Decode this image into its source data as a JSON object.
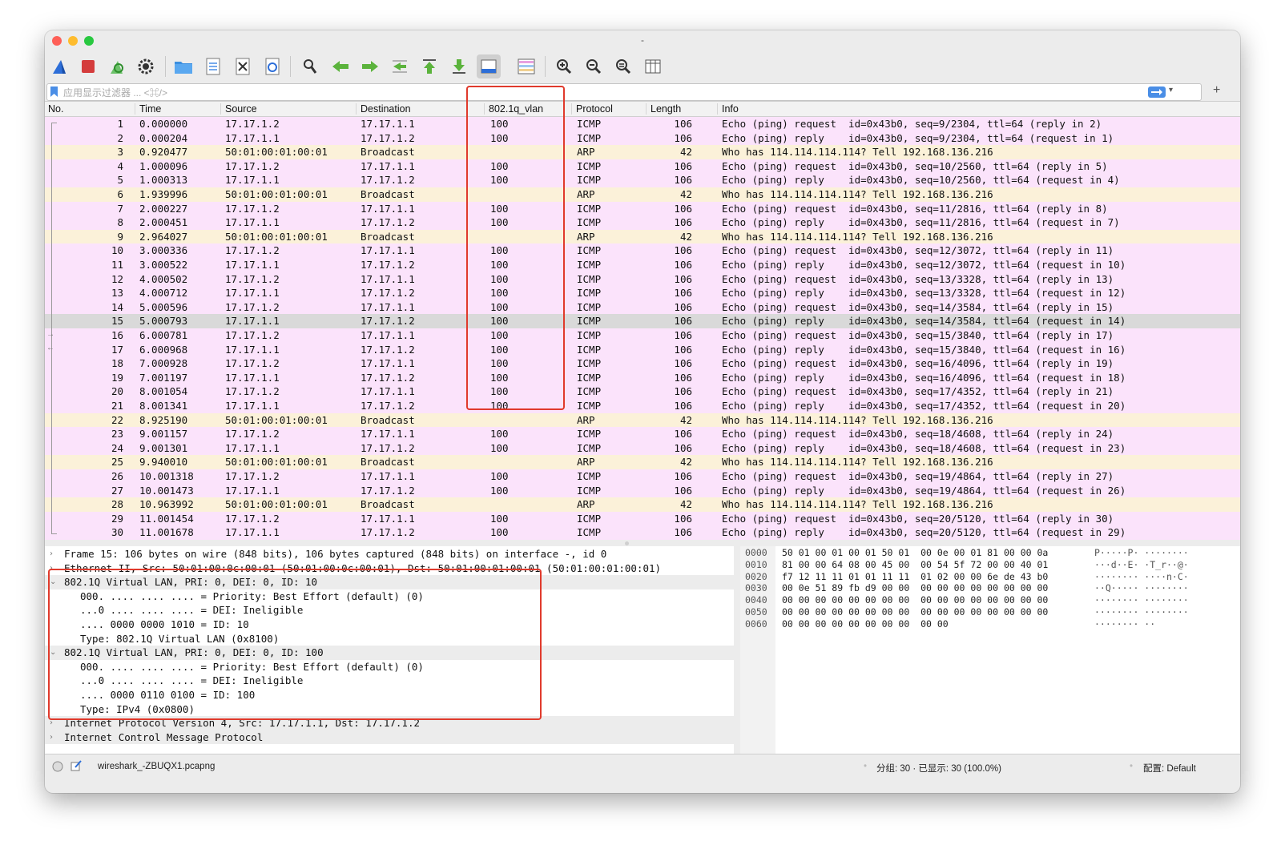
{
  "window": {
    "title": "-"
  },
  "filter": {
    "placeholder": "应用显示过滤器 ... <⌘/>"
  },
  "toolbar": {
    "icons": [
      "shark-fin-start-icon",
      "stop-capture-icon",
      "restart-capture-icon",
      "capture-options-gear-icon",
      "open-folder-icon",
      "save-file-icon",
      "close-file-icon",
      "reload-icon",
      "find-packet-icon",
      "go-back-arrow-icon",
      "go-forward-arrow-icon",
      "go-to-packet-icon",
      "go-first-packet-icon",
      "go-last-packet-icon",
      "autoscroll-icon",
      "colorize-icon",
      "zoom-in-icon",
      "zoom-out-icon",
      "zoom-reset-icon",
      "resize-columns-icon"
    ]
  },
  "columns": {
    "no": "No.",
    "time": "Time",
    "source": "Source",
    "destination": "Destination",
    "vlan": "802.1q_vlan",
    "protocol": "Protocol",
    "length": "Length",
    "info": "Info"
  },
  "packets": [
    {
      "no": "1",
      "time": "0.000000",
      "source": "17.17.1.2",
      "destination": "17.17.1.1",
      "vlan": "100",
      "protocol": "ICMP",
      "length": "106",
      "info": "Echo (ping) request  id=0x43b0, seq=9/2304, ttl=64 (reply in 2)",
      "type": "icmp"
    },
    {
      "no": "2",
      "time": "0.000204",
      "source": "17.17.1.1",
      "destination": "17.17.1.2",
      "vlan": "100",
      "protocol": "ICMP",
      "length": "106",
      "info": "Echo (ping) reply    id=0x43b0, seq=9/2304, ttl=64 (request in 1)",
      "type": "icmp"
    },
    {
      "no": "3",
      "time": "0.920477",
      "source": "50:01:00:01:00:01",
      "destination": "Broadcast",
      "vlan": "",
      "protocol": "ARP",
      "length": "42",
      "info": "Who has 114.114.114.114? Tell 192.168.136.216",
      "type": "arp"
    },
    {
      "no": "4",
      "time": "1.000096",
      "source": "17.17.1.2",
      "destination": "17.17.1.1",
      "vlan": "100",
      "protocol": "ICMP",
      "length": "106",
      "info": "Echo (ping) request  id=0x43b0, seq=10/2560, ttl=64 (reply in 5)",
      "type": "icmp"
    },
    {
      "no": "5",
      "time": "1.000313",
      "source": "17.17.1.1",
      "destination": "17.17.1.2",
      "vlan": "100",
      "protocol": "ICMP",
      "length": "106",
      "info": "Echo (ping) reply    id=0x43b0, seq=10/2560, ttl=64 (request in 4)",
      "type": "icmp"
    },
    {
      "no": "6",
      "time": "1.939996",
      "source": "50:01:00:01:00:01",
      "destination": "Broadcast",
      "vlan": "",
      "protocol": "ARP",
      "length": "42",
      "info": "Who has 114.114.114.114? Tell 192.168.136.216",
      "type": "arp"
    },
    {
      "no": "7",
      "time": "2.000227",
      "source": "17.17.1.2",
      "destination": "17.17.1.1",
      "vlan": "100",
      "protocol": "ICMP",
      "length": "106",
      "info": "Echo (ping) request  id=0x43b0, seq=11/2816, ttl=64 (reply in 8)",
      "type": "icmp"
    },
    {
      "no": "8",
      "time": "2.000451",
      "source": "17.17.1.1",
      "destination": "17.17.1.2",
      "vlan": "100",
      "protocol": "ICMP",
      "length": "106",
      "info": "Echo (ping) reply    id=0x43b0, seq=11/2816, ttl=64 (request in 7)",
      "type": "icmp"
    },
    {
      "no": "9",
      "time": "2.964027",
      "source": "50:01:00:01:00:01",
      "destination": "Broadcast",
      "vlan": "",
      "protocol": "ARP",
      "length": "42",
      "info": "Who has 114.114.114.114? Tell 192.168.136.216",
      "type": "arp"
    },
    {
      "no": "10",
      "time": "3.000336",
      "source": "17.17.1.2",
      "destination": "17.17.1.1",
      "vlan": "100",
      "protocol": "ICMP",
      "length": "106",
      "info": "Echo (ping) request  id=0x43b0, seq=12/3072, ttl=64 (reply in 11)",
      "type": "icmp"
    },
    {
      "no": "11",
      "time": "3.000522",
      "source": "17.17.1.1",
      "destination": "17.17.1.2",
      "vlan": "100",
      "protocol": "ICMP",
      "length": "106",
      "info": "Echo (ping) reply    id=0x43b0, seq=12/3072, ttl=64 (request in 10)",
      "type": "icmp"
    },
    {
      "no": "12",
      "time": "4.000502",
      "source": "17.17.1.2",
      "destination": "17.17.1.1",
      "vlan": "100",
      "protocol": "ICMP",
      "length": "106",
      "info": "Echo (ping) request  id=0x43b0, seq=13/3328, ttl=64 (reply in 13)",
      "type": "icmp"
    },
    {
      "no": "13",
      "time": "4.000712",
      "source": "17.17.1.1",
      "destination": "17.17.1.2",
      "vlan": "100",
      "protocol": "ICMP",
      "length": "106",
      "info": "Echo (ping) reply    id=0x43b0, seq=13/3328, ttl=64 (request in 12)",
      "type": "icmp"
    },
    {
      "no": "14",
      "time": "5.000596",
      "source": "17.17.1.2",
      "destination": "17.17.1.1",
      "vlan": "100",
      "protocol": "ICMP",
      "length": "106",
      "info": "Echo (ping) request  id=0x43b0, seq=14/3584, ttl=64 (reply in 15)",
      "type": "icmp"
    },
    {
      "no": "15",
      "time": "5.000793",
      "source": "17.17.1.1",
      "destination": "17.17.1.2",
      "vlan": "100",
      "protocol": "ICMP",
      "length": "106",
      "info": "Echo (ping) reply    id=0x43b0, seq=14/3584, ttl=64 (request in 14)",
      "type": "sel"
    },
    {
      "no": "16",
      "time": "6.000781",
      "source": "17.17.1.2",
      "destination": "17.17.1.1",
      "vlan": "100",
      "protocol": "ICMP",
      "length": "106",
      "info": "Echo (ping) request  id=0x43b0, seq=15/3840, ttl=64 (reply in 17)",
      "type": "icmp"
    },
    {
      "no": "17",
      "time": "6.000968",
      "source": "17.17.1.1",
      "destination": "17.17.1.2",
      "vlan": "100",
      "protocol": "ICMP",
      "length": "106",
      "info": "Echo (ping) reply    id=0x43b0, seq=15/3840, ttl=64 (request in 16)",
      "type": "icmp"
    },
    {
      "no": "18",
      "time": "7.000928",
      "source": "17.17.1.2",
      "destination": "17.17.1.1",
      "vlan": "100",
      "protocol": "ICMP",
      "length": "106",
      "info": "Echo (ping) request  id=0x43b0, seq=16/4096, ttl=64 (reply in 19)",
      "type": "icmp"
    },
    {
      "no": "19",
      "time": "7.001197",
      "source": "17.17.1.1",
      "destination": "17.17.1.2",
      "vlan": "100",
      "protocol": "ICMP",
      "length": "106",
      "info": "Echo (ping) reply    id=0x43b0, seq=16/4096, ttl=64 (request in 18)",
      "type": "icmp"
    },
    {
      "no": "20",
      "time": "8.001054",
      "source": "17.17.1.2",
      "destination": "17.17.1.1",
      "vlan": "100",
      "protocol": "ICMP",
      "length": "106",
      "info": "Echo (ping) request  id=0x43b0, seq=17/4352, ttl=64 (reply in 21)",
      "type": "icmp"
    },
    {
      "no": "21",
      "time": "8.001341",
      "source": "17.17.1.1",
      "destination": "17.17.1.2",
      "vlan": "100",
      "protocol": "ICMP",
      "length": "106",
      "info": "Echo (ping) reply    id=0x43b0, seq=17/4352, ttl=64 (request in 20)",
      "type": "icmp"
    },
    {
      "no": "22",
      "time": "8.925190",
      "source": "50:01:00:01:00:01",
      "destination": "Broadcast",
      "vlan": "",
      "protocol": "ARP",
      "length": "42",
      "info": "Who has 114.114.114.114? Tell 192.168.136.216",
      "type": "arp"
    },
    {
      "no": "23",
      "time": "9.001157",
      "source": "17.17.1.2",
      "destination": "17.17.1.1",
      "vlan": "100",
      "protocol": "ICMP",
      "length": "106",
      "info": "Echo (ping) request  id=0x43b0, seq=18/4608, ttl=64 (reply in 24)",
      "type": "icmp"
    },
    {
      "no": "24",
      "time": "9.001301",
      "source": "17.17.1.1",
      "destination": "17.17.1.2",
      "vlan": "100",
      "protocol": "ICMP",
      "length": "106",
      "info": "Echo (ping) reply    id=0x43b0, seq=18/4608, ttl=64 (request in 23)",
      "type": "icmp"
    },
    {
      "no": "25",
      "time": "9.940010",
      "source": "50:01:00:01:00:01",
      "destination": "Broadcast",
      "vlan": "",
      "protocol": "ARP",
      "length": "42",
      "info": "Who has 114.114.114.114? Tell 192.168.136.216",
      "type": "arp"
    },
    {
      "no": "26",
      "time": "10.001318",
      "source": "17.17.1.2",
      "destination": "17.17.1.1",
      "vlan": "100",
      "protocol": "ICMP",
      "length": "106",
      "info": "Echo (ping) request  id=0x43b0, seq=19/4864, ttl=64 (reply in 27)",
      "type": "icmp"
    },
    {
      "no": "27",
      "time": "10.001473",
      "source": "17.17.1.1",
      "destination": "17.17.1.2",
      "vlan": "100",
      "protocol": "ICMP",
      "length": "106",
      "info": "Echo (ping) reply    id=0x43b0, seq=19/4864, ttl=64 (request in 26)",
      "type": "icmp"
    },
    {
      "no": "28",
      "time": "10.963992",
      "source": "50:01:00:01:00:01",
      "destination": "Broadcast",
      "vlan": "",
      "protocol": "ARP",
      "length": "42",
      "info": "Who has 114.114.114.114? Tell 192.168.136.216",
      "type": "arp"
    },
    {
      "no": "29",
      "time": "11.001454",
      "source": "17.17.1.2",
      "destination": "17.17.1.1",
      "vlan": "100",
      "protocol": "ICMP",
      "length": "106",
      "info": "Echo (ping) request  id=0x43b0, seq=20/5120, ttl=64 (reply in 30)",
      "type": "icmp"
    },
    {
      "no": "30",
      "time": "11.001678",
      "source": "17.17.1.1",
      "destination": "17.17.1.2",
      "vlan": "100",
      "protocol": "ICMP",
      "length": "106",
      "info": "Echo (ping) reply    id=0x43b0, seq=20/5120, ttl=64 (request in 29)",
      "type": "icmp"
    }
  ],
  "details": [
    {
      "text": "Frame 15: 106 bytes on wire (848 bits), 106 bytes captured (848 bits) on interface -, id 0",
      "arrow": "›",
      "level": 0,
      "hdr": false
    },
    {
      "text": "Ethernet II, Src: 50:01:00:0c:00:01 (50:01:00:0c:00:01), Dst: 50:01:00:01:00:01 (50:01:00:01:00:01)",
      "arrow": "›",
      "level": 0,
      "hdr": false
    },
    {
      "text": "802.1Q Virtual LAN, PRI: 0, DEI: 0, ID: 10",
      "arrow": "⌄",
      "level": 0,
      "hdr": true
    },
    {
      "text": "000. .... .... .... = Priority: Best Effort (default) (0)",
      "arrow": "",
      "level": 1,
      "hdr": false
    },
    {
      "text": "...0 .... .... .... = DEI: Ineligible",
      "arrow": "",
      "level": 1,
      "hdr": false
    },
    {
      "text": ".... 0000 0000 1010 = ID: 10",
      "arrow": "",
      "level": 1,
      "hdr": false
    },
    {
      "text": "Type: 802.1Q Virtual LAN (0x8100)",
      "arrow": "",
      "level": 1,
      "hdr": false
    },
    {
      "text": "802.1Q Virtual LAN, PRI: 0, DEI: 0, ID: 100",
      "arrow": "⌄",
      "level": 0,
      "hdr": true
    },
    {
      "text": "000. .... .... .... = Priority: Best Effort (default) (0)",
      "arrow": "",
      "level": 1,
      "hdr": false
    },
    {
      "text": "...0 .... .... .... = DEI: Ineligible",
      "arrow": "",
      "level": 1,
      "hdr": false
    },
    {
      "text": ".... 0000 0110 0100 = ID: 100",
      "arrow": "",
      "level": 1,
      "hdr": false
    },
    {
      "text": "Type: IPv4 (0x0800)",
      "arrow": "",
      "level": 1,
      "hdr": false
    },
    {
      "text": "Internet Protocol Version 4, Src: 17.17.1.1, Dst: 17.17.1.2",
      "arrow": "›",
      "level": 0,
      "hdr": true
    },
    {
      "text": "Internet Control Message Protocol",
      "arrow": "›",
      "level": 0,
      "hdr": true
    }
  ],
  "bytes": [
    {
      "offset": "0000",
      "hex": "50 01 00 01 00 01 50 01  00 0e 00 01 81 00 00 0a",
      "ascii": "P·····P· ········"
    },
    {
      "offset": "0010",
      "hex": "81 00 00 64 08 00 45 00  00 54 5f 72 00 00 40 01",
      "ascii": "···d··E· ·T_r··@·"
    },
    {
      "offset": "0020",
      "hex": "f7 12 11 11 01 01 11 11  01 02 00 00 6e de 43 b0",
      "ascii": "········ ····n·C·"
    },
    {
      "offset": "0030",
      "hex": "00 0e 51 89 fb d9 00 00  00 00 00 00 00 00 00 00",
      "ascii": "··Q····· ········"
    },
    {
      "offset": "0040",
      "hex": "00 00 00 00 00 00 00 00  00 00 00 00 00 00 00 00",
      "ascii": "········ ········"
    },
    {
      "offset": "0050",
      "hex": "00 00 00 00 00 00 00 00  00 00 00 00 00 00 00 00",
      "ascii": "········ ········"
    },
    {
      "offset": "0060",
      "hex": "00 00 00 00 00 00 00 00  00 00",
      "ascii": "········ ··"
    }
  ],
  "status": {
    "file": "wireshark_-ZBUQX1.pcapng",
    "counts": "分组: 30 · 已显示: 30 (100.0%)",
    "profile": "配置: Default"
  },
  "colors": {
    "icmp_row": "#fbe3fb",
    "arp_row": "#fbf1d9",
    "selected_row": "#d9d9d9",
    "highlight_box": "#e03a2c"
  }
}
